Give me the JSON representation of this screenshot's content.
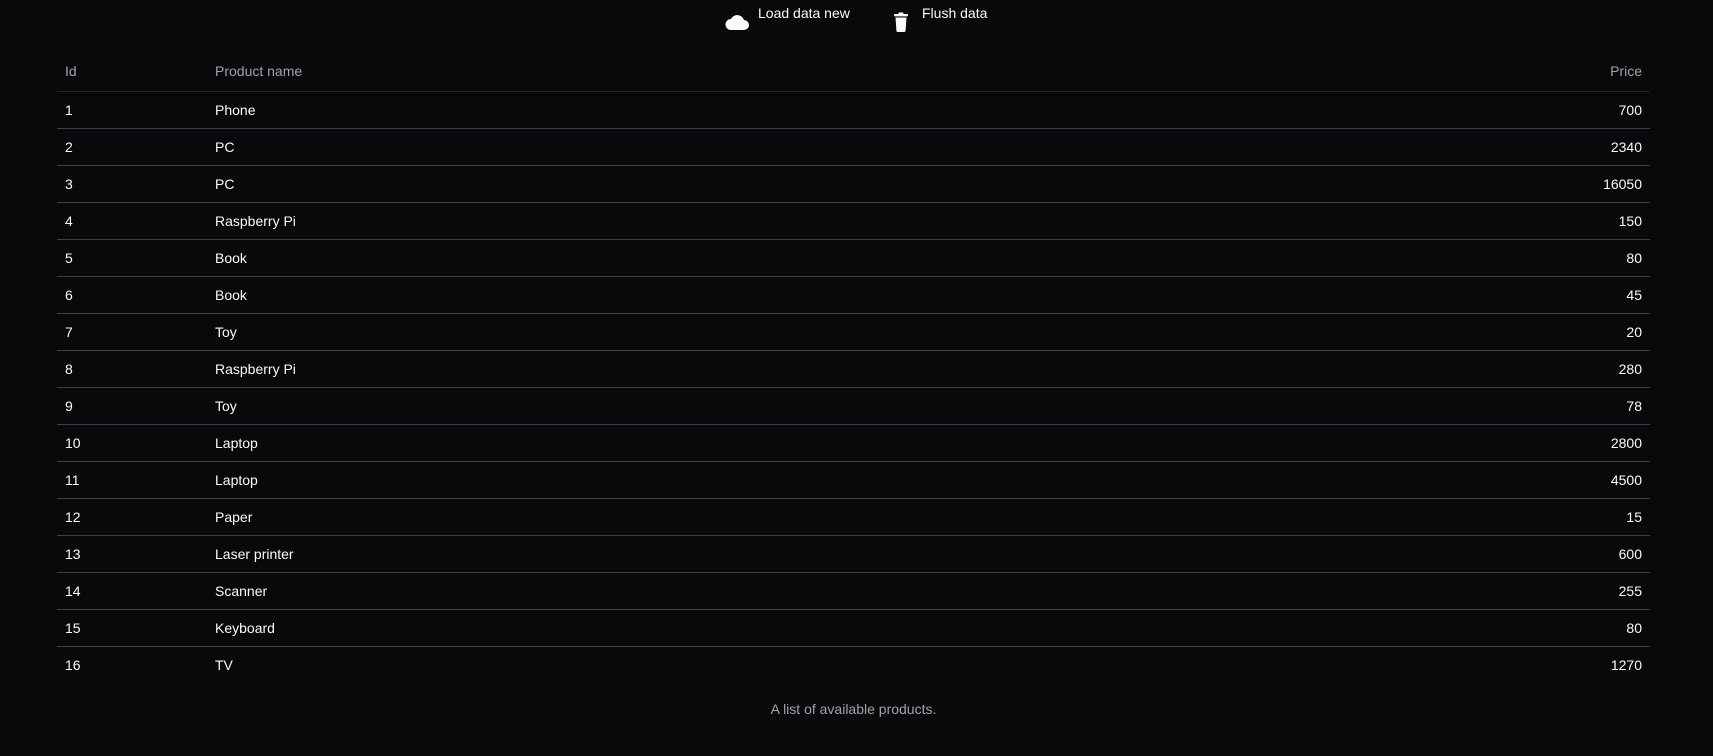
{
  "toolbar": {
    "load_label": "Load data new",
    "load_icon": "cloud-icon",
    "flush_label": "Flush data",
    "flush_icon": "trash-icon"
  },
  "table": {
    "headers": [
      "Id",
      "Product name",
      "Price"
    ],
    "rows": [
      [
        "1",
        "Phone",
        "700"
      ],
      [
        "2",
        "PC",
        "2340"
      ],
      [
        "3",
        "PC",
        "16050"
      ],
      [
        "4",
        "Raspberry Pi",
        "150"
      ],
      [
        "5",
        "Book",
        "80"
      ],
      [
        "6",
        "Book",
        "45"
      ],
      [
        "7",
        "Toy",
        "20"
      ],
      [
        "8",
        "Raspberry Pi",
        "280"
      ],
      [
        "9",
        "Toy",
        "78"
      ],
      [
        "10",
        "Laptop",
        "2800"
      ],
      [
        "11",
        "Laptop",
        "4500"
      ],
      [
        "12",
        "Paper",
        "15"
      ],
      [
        "13",
        "Laser printer",
        "600"
      ],
      [
        "14",
        "Scanner",
        "255"
      ],
      [
        "15",
        "Keyboard",
        "80"
      ],
      [
        "16",
        "TV",
        "1270"
      ]
    ],
    "caption": "A list of available products."
  },
  "colors": {
    "background": "#09090b",
    "text": "#fafafa",
    "muted": "#a1a1aa",
    "border": "#3f3f46"
  }
}
